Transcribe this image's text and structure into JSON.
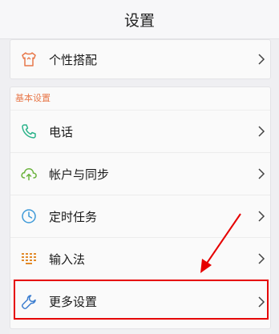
{
  "header": {
    "title": "设置"
  },
  "top_item": {
    "label": "个性搭配",
    "icon": "shirt-icon"
  },
  "section": {
    "label": "基本设置",
    "items": [
      {
        "label": "电话",
        "icon": "phone-icon"
      },
      {
        "label": "帐户与同步",
        "icon": "cloud-sync-icon"
      },
      {
        "label": "定时任务",
        "icon": "clock-icon"
      },
      {
        "label": "输入法",
        "icon": "keyboard-icon"
      },
      {
        "label": "更多设置",
        "icon": "wrench-icon"
      }
    ]
  },
  "colors": {
    "accent_orange": "#e8784a",
    "phone_green": "#2bb38a",
    "sync_green": "#6cb33f",
    "clock_blue": "#3e9ad8",
    "keyboard_orange": "#e28a2a",
    "wrench_blue": "#3e7fd0",
    "annotation_red": "#e60000"
  }
}
